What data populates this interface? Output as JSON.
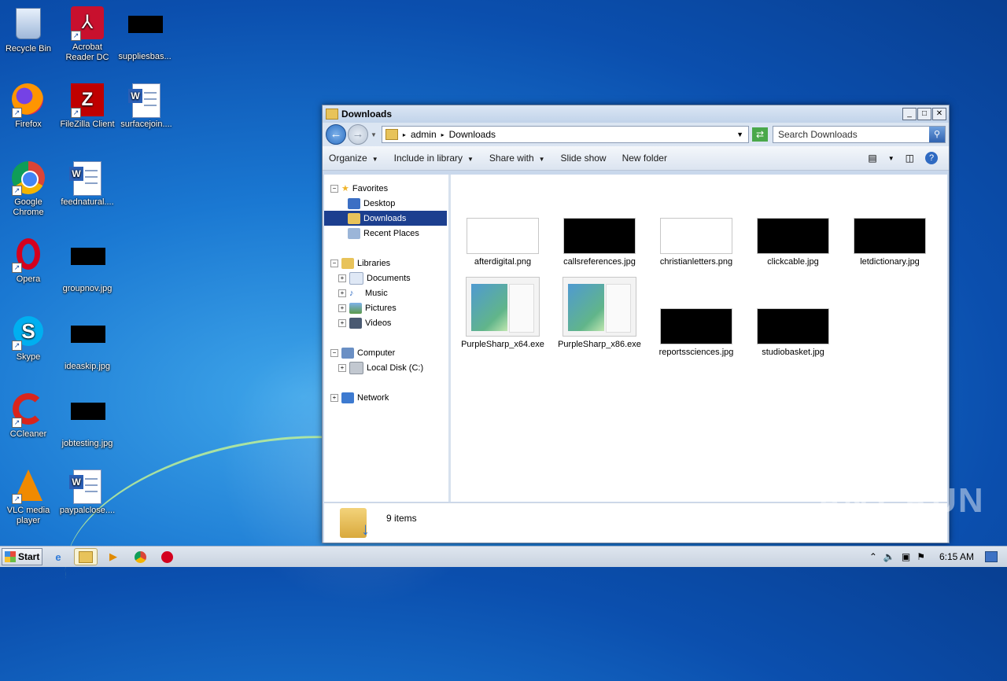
{
  "desktop": {
    "icons": [
      {
        "label": "Recycle Bin"
      },
      {
        "label": "Acrobat Reader DC"
      },
      {
        "label": "suppliesbas..."
      },
      {
        "label": "Firefox"
      },
      {
        "label": "FileZilla Client"
      },
      {
        "label": "surfacejoin...."
      },
      {
        "label": "Google Chrome"
      },
      {
        "label": "feednatural...."
      },
      {
        "label": "Opera"
      },
      {
        "label": "groupnov.jpg"
      },
      {
        "label": "Skype"
      },
      {
        "label": "ideaskip.jpg"
      },
      {
        "label": "CCleaner"
      },
      {
        "label": "jobtesting.jpg"
      },
      {
        "label": "VLC media player"
      },
      {
        "label": "paypalclose...."
      }
    ]
  },
  "window": {
    "title": "Downloads",
    "buttons": {
      "minimize": "_",
      "maximize": "□",
      "close": "✕"
    },
    "breadcrumb": [
      "admin",
      "Downloads"
    ],
    "search_placeholder": "Search Downloads",
    "toolbar": {
      "organize": "Organize",
      "include": "Include in library",
      "share": "Share with",
      "slideshow": "Slide show",
      "newfolder": "New folder"
    },
    "nav": {
      "favorites": "Favorites",
      "desktop": "Desktop",
      "downloads": "Downloads",
      "recent": "Recent Places",
      "libraries": "Libraries",
      "documents": "Documents",
      "music": "Music",
      "pictures": "Pictures",
      "videos": "Videos",
      "computer": "Computer",
      "localdisk": "Local Disk (C:)",
      "network": "Network"
    },
    "files": [
      {
        "name": "afterdigital.png"
      },
      {
        "name": "callsreferences.jpg"
      },
      {
        "name": "christianletters.png"
      },
      {
        "name": "clickcable.jpg"
      },
      {
        "name": "letdictionary.jpg"
      },
      {
        "name": "PurpleSharp_x64.exe"
      },
      {
        "name": "PurpleSharp_x86.exe"
      },
      {
        "name": "reportssciences.jpg"
      },
      {
        "name": "studiobasket.jpg"
      }
    ],
    "status_count": "9 items"
  },
  "watermark": "ANY RUN",
  "taskbar": {
    "start": "Start",
    "clock": "6:15 AM"
  }
}
